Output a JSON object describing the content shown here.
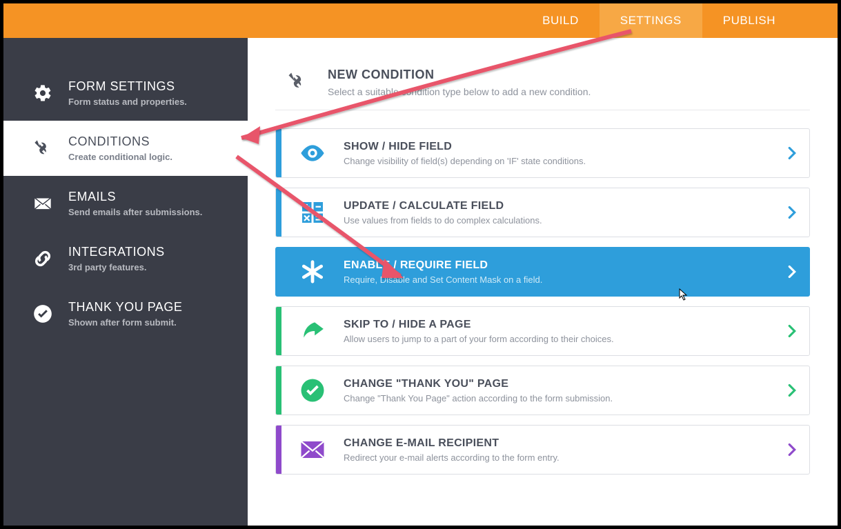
{
  "header": {
    "tabs": [
      {
        "label": "BUILD"
      },
      {
        "label": "SETTINGS"
      },
      {
        "label": "PUBLISH"
      }
    ],
    "active_index": 1
  },
  "sidebar": {
    "items": [
      {
        "title": "FORM SETTINGS",
        "desc": "Form status and properties.",
        "icon": "gear-icon"
      },
      {
        "title": "CONDITIONS",
        "desc": "Create conditional logic.",
        "icon": "wrench-icon"
      },
      {
        "title": "EMAILS",
        "desc": "Send emails after submissions.",
        "icon": "envelope-icon"
      },
      {
        "title": "INTEGRATIONS",
        "desc": "3rd party features.",
        "icon": "link-icon"
      },
      {
        "title": "THANK YOU PAGE",
        "desc": "Shown after form submit.",
        "icon": "check-circle-icon"
      }
    ],
    "active_index": 1
  },
  "section": {
    "title": "NEW CONDITION",
    "desc": "Select a suitable condition type below to add a new condition."
  },
  "cards": [
    {
      "title": "SHOW / HIDE FIELD",
      "desc": "Change visibility of field(s) depending on 'IF' state conditions.",
      "color": "#2e9edb",
      "icon": "eye-icon"
    },
    {
      "title": "UPDATE / CALCULATE FIELD",
      "desc": "Use values from fields to do complex calculations.",
      "color": "#2e9edb",
      "icon": "calculator-icon"
    },
    {
      "title": "ENABLE / REQUIRE FIELD",
      "desc": "Require, Disable and Set Content Mask on a field.",
      "color": "#2e9edb",
      "icon": "asterisk-icon",
      "highlight": true
    },
    {
      "title": "SKIP TO / HIDE A PAGE",
      "desc": "Allow users to jump to a part of your form according to their choices.",
      "color": "#29c075",
      "icon": "forward-arrow-icon"
    },
    {
      "title": "CHANGE \"THANK YOU\" PAGE",
      "desc": "Change \"Thank You Page\" action according to the form submission.",
      "color": "#29c075",
      "icon": "check-circle-icon"
    },
    {
      "title": "CHANGE E-MAIL RECIPIENT",
      "desc": "Redirect your e-mail alerts according to the form entry.",
      "color": "#8f4acb",
      "icon": "envelope-icon"
    }
  ]
}
